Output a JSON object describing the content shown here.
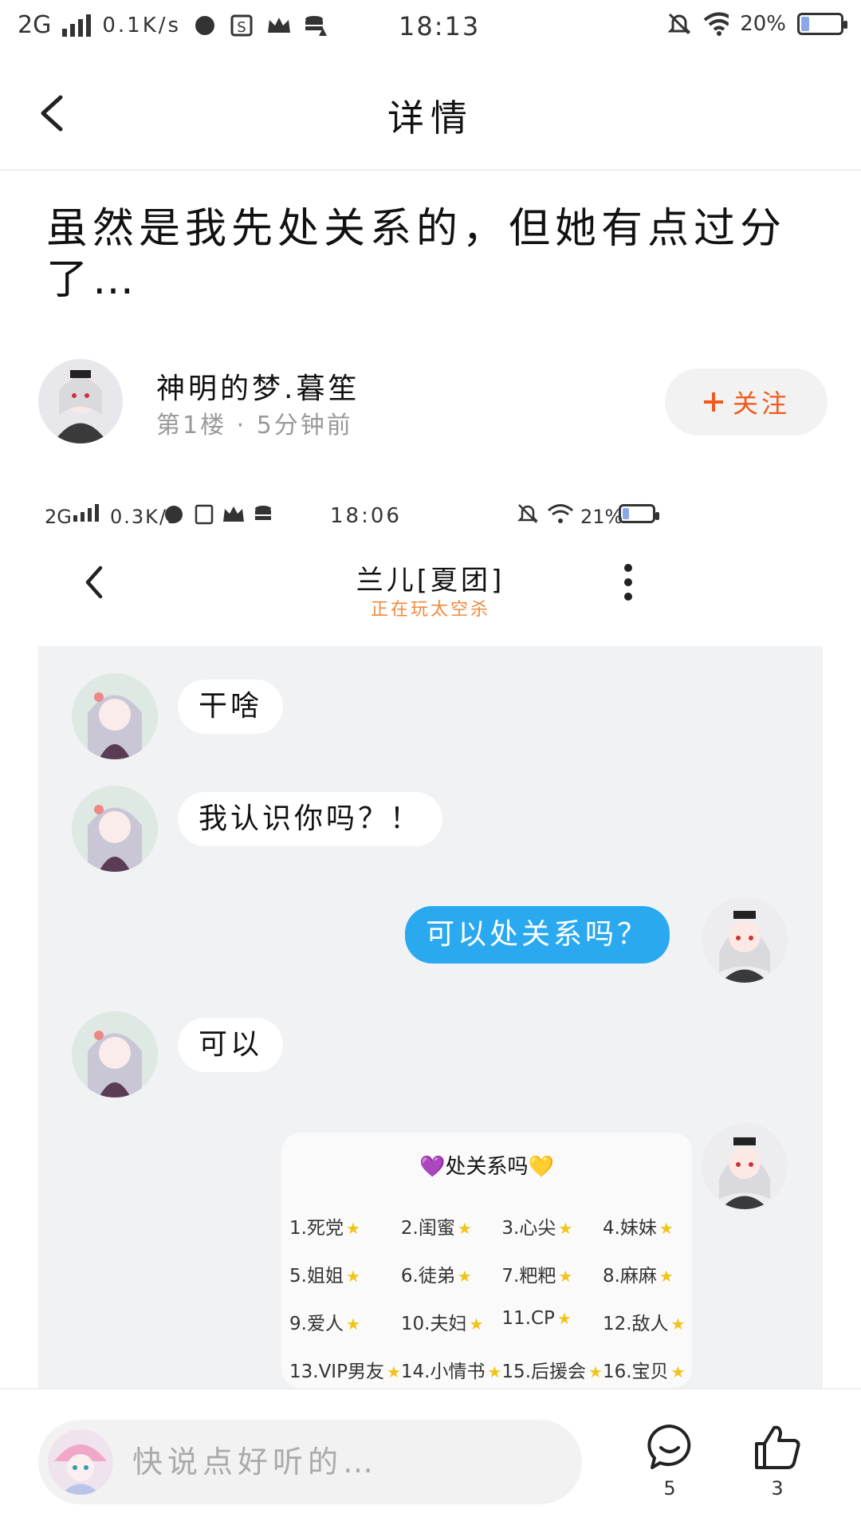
{
  "status_bar": {
    "network": "2G",
    "speed": "0.1K/s",
    "time": "18:13",
    "battery": "20%",
    "battery_level": 0.2
  },
  "nav": {
    "title": "详情"
  },
  "post": {
    "title": "虽然是我先处关系的，但她有点过分了…",
    "author_name": "神明的梦.暮笙",
    "author_meta": "第1楼 · 5分钟前",
    "follow_label": "关注"
  },
  "screenshot": {
    "status_bar": {
      "network": "2G",
      "speed": "0.3K/s",
      "time": "18:06",
      "battery": "21%",
      "battery_level": 0.21
    },
    "chat_title": "兰儿[夏团]",
    "chat_subtitle": "正在玩太空杀",
    "messages": [
      {
        "side": "left",
        "text": "干啥"
      },
      {
        "side": "left",
        "text": "我认识你吗？！"
      },
      {
        "side": "right",
        "text": "可以处关系吗？"
      },
      {
        "side": "left",
        "text": "可以"
      }
    ],
    "card": {
      "title": "💜处关系吗💛",
      "items": [
        "1.死党",
        "2.闺蜜",
        "3.心尖",
        "4.妹妹",
        "5.姐姐",
        "6.徒弟",
        "7.粑粑",
        "8.麻麻",
        "9.爱人",
        "10.夫妇",
        "11.CP",
        "12.敌人",
        "13.VIP男友",
        "14.小情书",
        "15.后援会",
        "16.宝贝"
      ]
    }
  },
  "bottom": {
    "input_placeholder": "快说点好听的…",
    "comment_count": "5",
    "like_count": "3"
  },
  "colors": {
    "accent": "#f15a1f",
    "bubble_blue": "#2aa9f0",
    "chat_bg": "#f1f2f4"
  }
}
